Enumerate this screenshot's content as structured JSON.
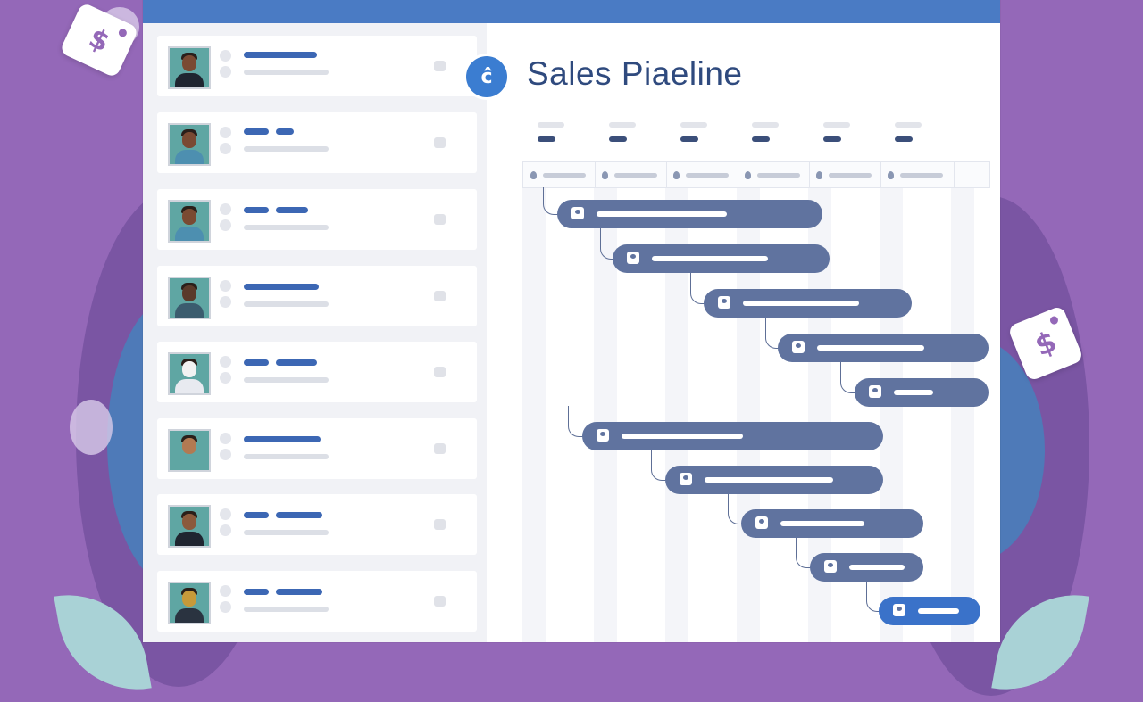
{
  "app": {
    "title": "Sales Piaeline",
    "logo_icon": "pipeline-logo-icon",
    "logo_glyph": "ĉ",
    "accent": "#3b7dd1",
    "bar_color": "#60739f",
    "background": "#9468b8"
  },
  "decor": {
    "tag_glyph": "$"
  }
}
